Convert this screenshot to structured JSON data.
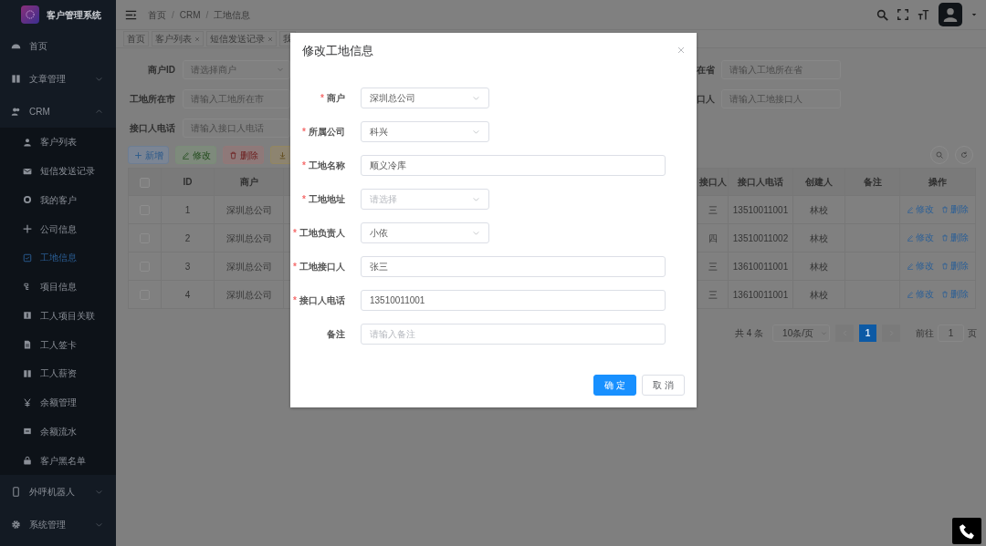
{
  "sidebar": {
    "title": "客户管理系统",
    "items": [
      {
        "label": "首页"
      },
      {
        "label": "文章管理",
        "expanded": false
      },
      {
        "label": "CRM",
        "expanded": true,
        "children": [
          {
            "label": "客户列表",
            "selected": false
          },
          {
            "label": "短信发送记录",
            "selected": false
          },
          {
            "label": "我的客户",
            "selected": false
          },
          {
            "label": "公司信息",
            "selected": false
          },
          {
            "label": "工地信息",
            "selected": true
          },
          {
            "label": "项目信息",
            "selected": false
          },
          {
            "label": "工人项目关联",
            "selected": false
          },
          {
            "label": "工人签卡",
            "selected": false
          },
          {
            "label": "工人薪资",
            "selected": false
          },
          {
            "label": "余额管理",
            "selected": false
          },
          {
            "label": "余额流水",
            "selected": false
          },
          {
            "label": "客户黑名单",
            "selected": false
          }
        ]
      },
      {
        "label": "外呼机器人",
        "expanded": false
      },
      {
        "label": "系统管理",
        "expanded": false
      }
    ]
  },
  "header": {
    "breadcrumb": [
      "首页",
      "CRM",
      "工地信息"
    ],
    "separator": "/"
  },
  "tags": [
    {
      "label": "首页",
      "closable": false
    },
    {
      "label": "客户列表",
      "closable": true
    },
    {
      "label": "短信发送记录",
      "closable": true
    },
    {
      "label": "我",
      "closable": false
    }
  ],
  "filters": {
    "left": [
      {
        "label": "商户ID",
        "kind": "select",
        "placeholder": "请选择商户"
      },
      {
        "label": "工地所在市",
        "kind": "input",
        "placeholder": "请输入工地所在市"
      },
      {
        "label": "接口人电话",
        "kind": "input",
        "placeholder": "请输入接口人电话"
      }
    ],
    "right": [
      {
        "label": "在省",
        "placeholder": "请输入工地所在省"
      },
      {
        "label": "口人",
        "placeholder": "请输入工地接口人"
      }
    ]
  },
  "toolbar": [
    {
      "kind": "primary",
      "label": "新增"
    },
    {
      "kind": "success",
      "label": "修改"
    },
    {
      "kind": "danger",
      "label": "删除"
    },
    {
      "kind": "warning"
    }
  ],
  "table": {
    "columns": [
      {
        "kind": "checkbox",
        "checked": false
      },
      {
        "kind": "text",
        "label": "ID"
      },
      {
        "kind": "text",
        "label": "商户"
      },
      {
        "kind": "text",
        "label": "接口人"
      },
      {
        "kind": "text",
        "label": "接口人电话"
      },
      {
        "kind": "text",
        "label": "创建人"
      },
      {
        "kind": "text",
        "label": "备注"
      },
      {
        "kind": "actions",
        "label": "操作"
      }
    ],
    "rows": [
      {
        "checked": false,
        "cells": [
          null,
          "1",
          "深圳总公司",
          "三",
          "13510011001",
          "林校",
          null,
          null
        ],
        "actions": [
          {
            "kind": "edit",
            "label": "修改"
          },
          {
            "kind": "delete",
            "label": "删除"
          }
        ]
      },
      {
        "checked": false,
        "cells": [
          null,
          "2",
          "深圳总公司",
          "四",
          "13510011002",
          "林校",
          null,
          null
        ],
        "actions": [
          {
            "kind": "edit",
            "label": "修改"
          },
          {
            "kind": "delete",
            "label": "删除"
          }
        ]
      },
      {
        "checked": false,
        "cells": [
          null,
          "3",
          "深圳总公司",
          "三",
          "13610011001",
          "林校",
          null,
          null
        ],
        "actions": [
          {
            "kind": "edit",
            "label": "修改"
          },
          {
            "kind": "delete",
            "label": "删除"
          }
        ]
      },
      {
        "checked": false,
        "cells": [
          null,
          "4",
          "深圳总公司",
          "三",
          "13610011001",
          "林校",
          null,
          null
        ],
        "actions": [
          {
            "kind": "edit",
            "label": "修改"
          },
          {
            "kind": "delete",
            "label": "删除"
          }
        ]
      }
    ]
  },
  "pagination": {
    "total": "共 4 条",
    "page_size": "10条/页",
    "pages": [
      {
        "label": "1",
        "selected": true
      }
    ],
    "goto_label": "前往",
    "goto_value": "1",
    "goto_suffix": "页"
  },
  "dialog": {
    "title": "修改工地信息",
    "required_mark": "*",
    "fields": [
      {
        "label": "商户",
        "required": true,
        "kind": "select",
        "value": "深圳总公司"
      },
      {
        "label": "所属公司",
        "required": true,
        "kind": "select",
        "value": "科兴"
      },
      {
        "label": "工地名称",
        "required": true,
        "kind": "input",
        "value": "顺义冷库"
      },
      {
        "label": "工地地址",
        "required": true,
        "kind": "select",
        "placeholder": "请选择"
      },
      {
        "label": "工地负责人",
        "required": true,
        "kind": "select",
        "value": "小依"
      },
      {
        "label": "工地接口人",
        "required": true,
        "kind": "input",
        "value": "张三"
      },
      {
        "label": "接口人电话",
        "required": true,
        "kind": "input",
        "value": "13510011001"
      },
      {
        "label": "备注",
        "required": false,
        "kind": "input",
        "placeholder": "请输入备注"
      }
    ],
    "buttons": [
      {
        "kind": "primary",
        "label": "确定"
      },
      {
        "kind": "default",
        "label": "取消"
      }
    ]
  }
}
